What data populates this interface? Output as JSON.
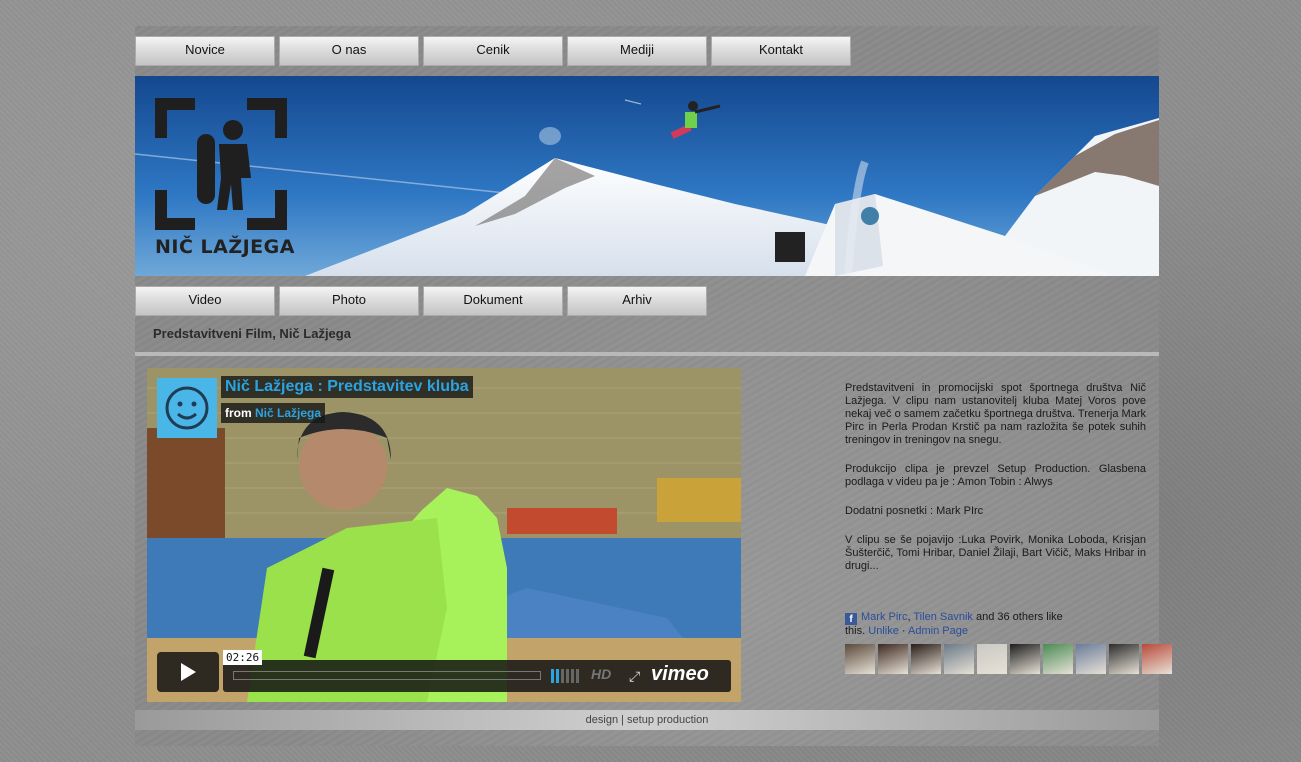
{
  "nav_top": [
    {
      "label": "Novice"
    },
    {
      "label": "O nas"
    },
    {
      "label": "Cenik"
    },
    {
      "label": "Mediji"
    },
    {
      "label": "Kontakt"
    }
  ],
  "banner": {
    "logo_text": "NIČ LAŽJEGA"
  },
  "nav_sub": [
    {
      "label": "Video"
    },
    {
      "label": "Photo"
    },
    {
      "label": "Dokument"
    },
    {
      "label": "Arhiv"
    }
  ],
  "section_title": "Predstavitveni Film, Nič Lažjega",
  "video": {
    "title": "Nič Lažjega : Predstavitev kluba",
    "from_label": "from",
    "author": "Nič Lažjega",
    "time": "02:26",
    "progress": 0.0,
    "hd_label": "HD",
    "brand": "vimeo"
  },
  "description": [
    "Predstavitveni in promocijski spot športnega društva Nič Lažjega. V clipu nam ustanovitelj kluba Matej Voros pove nekaj več o samem začetku športnega društva. Trenerja Mark Pirc in Perla Prodan Krstič pa nam razložita še potek suhih treningov in treningov na snegu.",
    "Produkcijo clipa je prevzel Setup Production. Glasbena podlaga v videu pa je : Amon Tobin : Alwys",
    "Dodatni posnetki : Mark PIrc",
    "V clipu se še pojavijo :Luka Povirk, Monika Loboda, Krisjan Šušterčič, Tomi Hribar, Daniel Žilaji, Bart Vičič, Maks Hribar in drugi..."
  ],
  "facebook": {
    "icon": "f",
    "friend1": "Mark Pirc",
    "separator": ",",
    "friend2": "Tilen Savnik",
    "others_text": "and 36 others like this.",
    "unlike": "Unlike",
    "dot": "·",
    "admin_page": "Admin Page",
    "face_colors": [
      "#5a4a3a",
      "#3d2a22",
      "#2a1c18",
      "#6a7a88",
      "#c9c9c4",
      "#1e1e1e",
      "#4a8c54",
      "#6a7c9a",
      "#2c2c2c",
      "#b84a3a"
    ]
  },
  "footer": {
    "text": "design | setup production"
  }
}
